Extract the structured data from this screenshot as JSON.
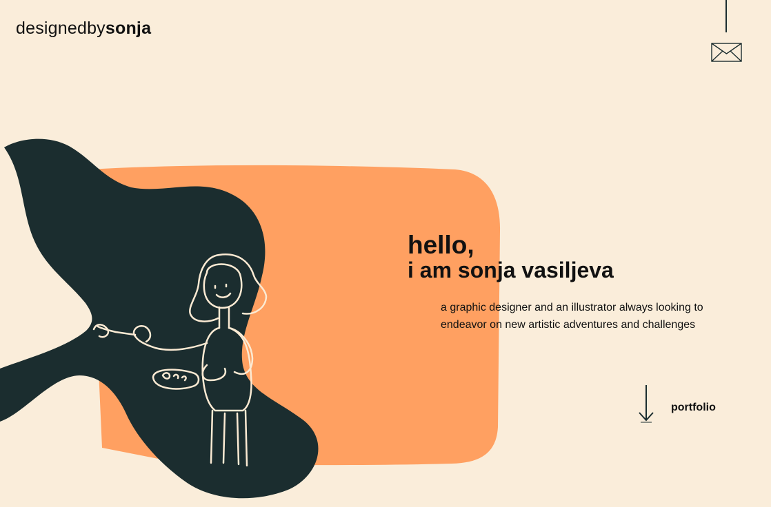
{
  "brand": {
    "logo_light": "designedby",
    "logo_bold": "sonja"
  },
  "hero": {
    "title_line1": "hello,",
    "title_line2": "i am sonja vasiljeva",
    "description": "a graphic designer and an illustrator always looking to endeavor on new artistic adventures and challenges"
  },
  "nav": {
    "portfolio_label": "portfolio",
    "arrow_icon": "arrow-down-icon",
    "contact_icon": "envelope-icon"
  },
  "colors": {
    "background": "#FAEDDA",
    "accent_orange": "#FFA061",
    "dark_teal": "#1B2D2F",
    "line_art": "#FBEAD3",
    "text": "#111111"
  }
}
